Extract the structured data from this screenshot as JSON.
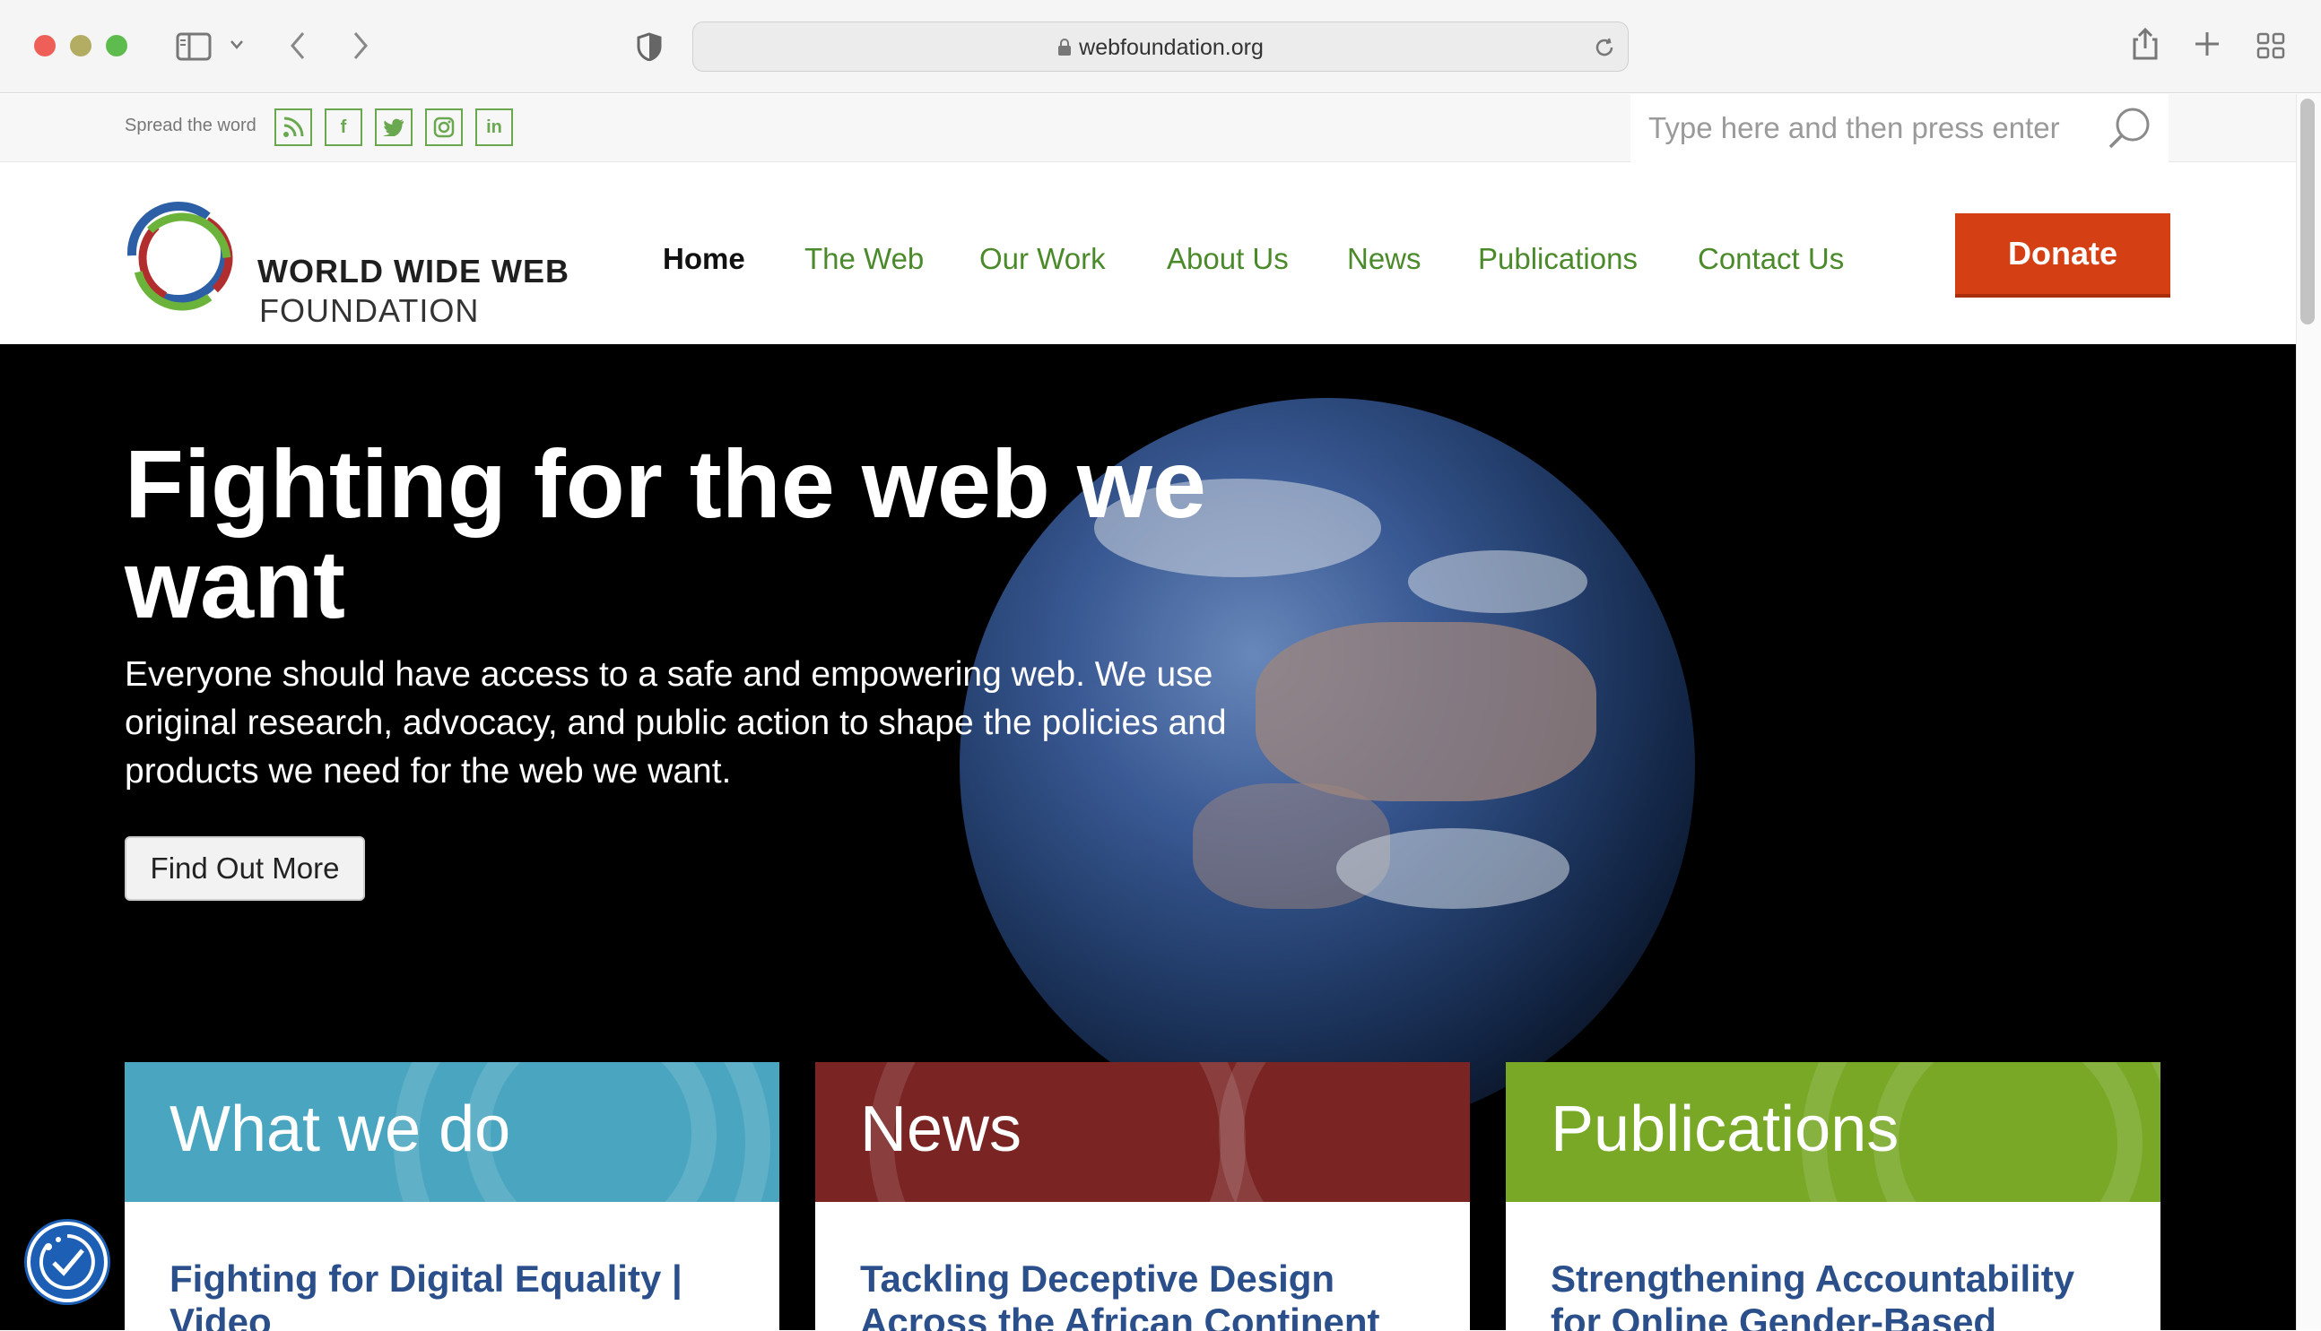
{
  "browser": {
    "url": "webfoundation.org"
  },
  "topbar": {
    "spread_label": "Spread the word",
    "social": [
      {
        "icon": "rss-icon",
        "glyph": "◥"
      },
      {
        "icon": "facebook-icon",
        "glyph": "f"
      },
      {
        "icon": "twitter-icon",
        "glyph": "t"
      },
      {
        "icon": "instagram-icon",
        "glyph": "◎"
      },
      {
        "icon": "linkedin-icon",
        "glyph": "in"
      }
    ],
    "search_placeholder": "Type here and then press enter"
  },
  "header": {
    "logo_line1": "WORLD WIDE WEB",
    "logo_line2": "FOUNDATION",
    "nav": [
      "Home",
      "The Web",
      "Our Work",
      "About Us",
      "News",
      "Publications",
      "Contact Us"
    ],
    "donate": "Donate"
  },
  "hero": {
    "title": "Fighting for the web we want",
    "text": "Everyone should have access to a safe and empowering web. We use original research, advocacy, and public action to shape the policies and products we need for the web we want.",
    "button": "Find Out More"
  },
  "cards": [
    {
      "title": "What we do",
      "link": "Fighting for Digital Equality | Video",
      "color": "#4aa6c0"
    },
    {
      "title": "News",
      "link": "Tackling Deceptive Design Across the African Continent",
      "color": "#7a2424"
    },
    {
      "title": "Publications",
      "link": "Strengthening Accountability for Online Gender-Based Violence –",
      "color": "#78a825"
    }
  ],
  "colors": {
    "nav_green": "#4b8a2a",
    "donate_orange": "#d43f14",
    "link_blue": "#2a4f8a"
  }
}
